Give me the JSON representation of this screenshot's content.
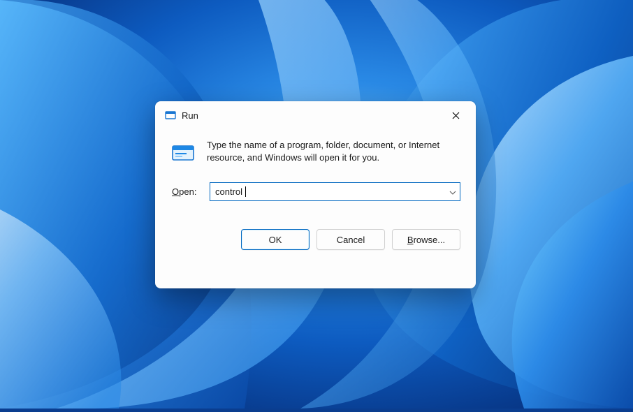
{
  "dialog": {
    "title": "Run",
    "description": "Type the name of a program, folder, document, or Internet resource, and Windows will open it for you.",
    "open_label_html": "Open:",
    "open_label_underline": "O",
    "open_label_rest": "pen:",
    "input_value": "control",
    "buttons": {
      "ok": "OK",
      "cancel": "Cancel",
      "browse_underline": "B",
      "browse_rest": "rowse..."
    }
  },
  "icons": {
    "run": "run-icon",
    "close": "close-icon",
    "chevron": "chevron-down-icon"
  }
}
